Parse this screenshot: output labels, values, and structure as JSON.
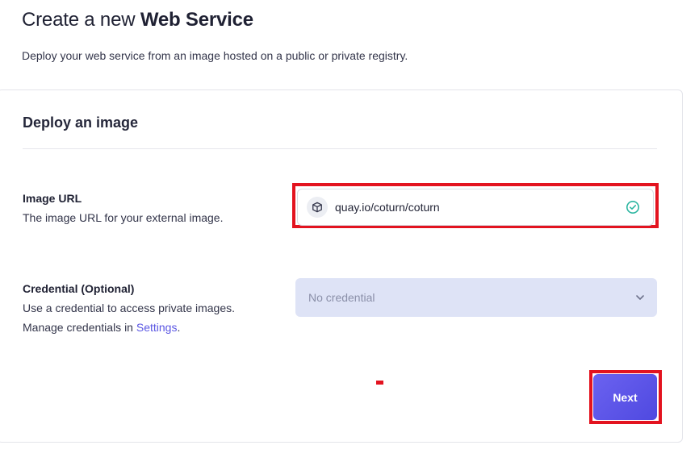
{
  "header": {
    "title_prefix": "Create a new ",
    "title_bold": "Web Service",
    "subtitle": "Deploy your web service from an image hosted on a public or private registry."
  },
  "card": {
    "title": "Deploy an image"
  },
  "image_url": {
    "label": "Image URL",
    "description": "The image URL for your external image.",
    "value": "quay.io/coturn/coturn",
    "icon": "cube-icon",
    "status_icon": "check-circle-icon"
  },
  "credential": {
    "label": "Credential (Optional)",
    "description_line1": "Use a credential to access private images.",
    "description_line2_prefix": "Manage credentials in ",
    "settings_link": "Settings",
    "description_line2_suffix": ".",
    "selected": "No credential"
  },
  "actions": {
    "next_label": "Next"
  },
  "colors": {
    "accent": "#5b57e3",
    "highlight": "#e3131f",
    "success": "#2bb5a0",
    "select_bg": "#dee3f6"
  }
}
